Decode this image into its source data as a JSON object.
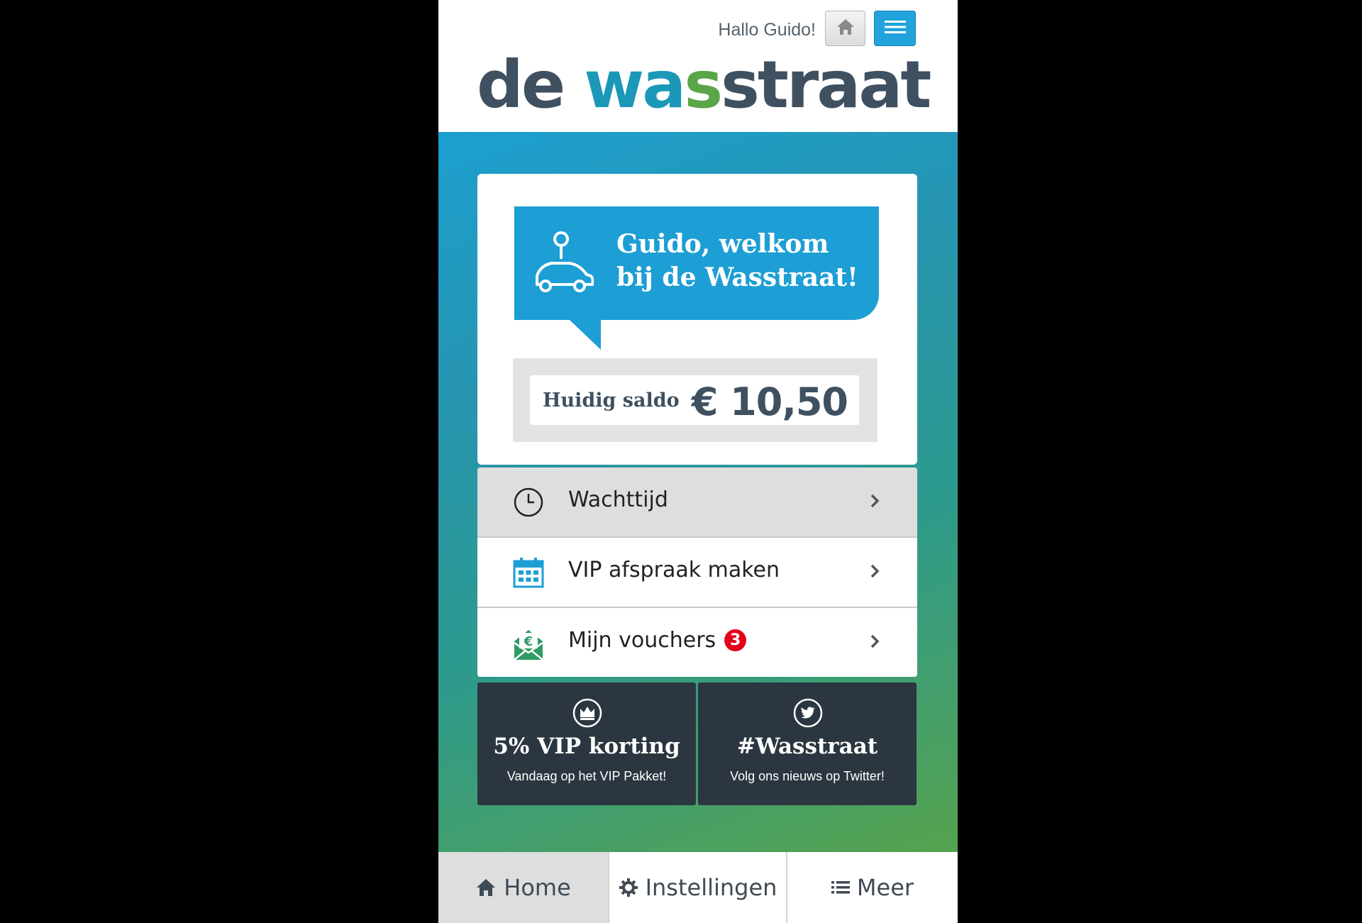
{
  "header": {
    "greeting": "Hallo Guido!",
    "home_button_icon": "home-icon",
    "menu_button_icon": "hamburger-menu-icon",
    "logo": {
      "part1": "de ",
      "part2": "wa",
      "part3": "s",
      "part4": "straat"
    }
  },
  "welcome": {
    "line1": "Guido, welkom",
    "line2": "bij de Wasstraat!",
    "icon": "car-location-pin-icon",
    "balance_label": "Huidig saldo",
    "balance_value": "€ 10,50"
  },
  "menu": {
    "items": [
      {
        "label": "Wachttijd",
        "icon": "clock-icon",
        "active": true
      },
      {
        "label": "VIP afspraak maken",
        "icon": "calendar-icon",
        "active": false
      },
      {
        "label": "Mijn vouchers",
        "icon": "voucher-envelope-icon",
        "badge": "3",
        "active": false
      }
    ]
  },
  "tiles": [
    {
      "title": "5% VIP korting",
      "subtitle": "Vandaag op het VIP Pakket!",
      "icon": "crown-icon"
    },
    {
      "title": "#Wasstraat",
      "subtitle": "Volg ons nieuws op Twitter!",
      "icon": "twitter-icon"
    }
  ],
  "tabbar": {
    "tabs": [
      {
        "label": "Home",
        "icon": "home-icon",
        "active": true
      },
      {
        "label": "Instellingen",
        "icon": "gear-icon",
        "active": false
      },
      {
        "label": "Meer",
        "icon": "list-icon",
        "active": false
      }
    ]
  },
  "colors": {
    "brand_dark": "#3f5060",
    "brand_blue": "#1d9ed4",
    "brand_green": "#5aa548",
    "badge_red": "#e3001b",
    "tile_dark": "#2b3640"
  }
}
